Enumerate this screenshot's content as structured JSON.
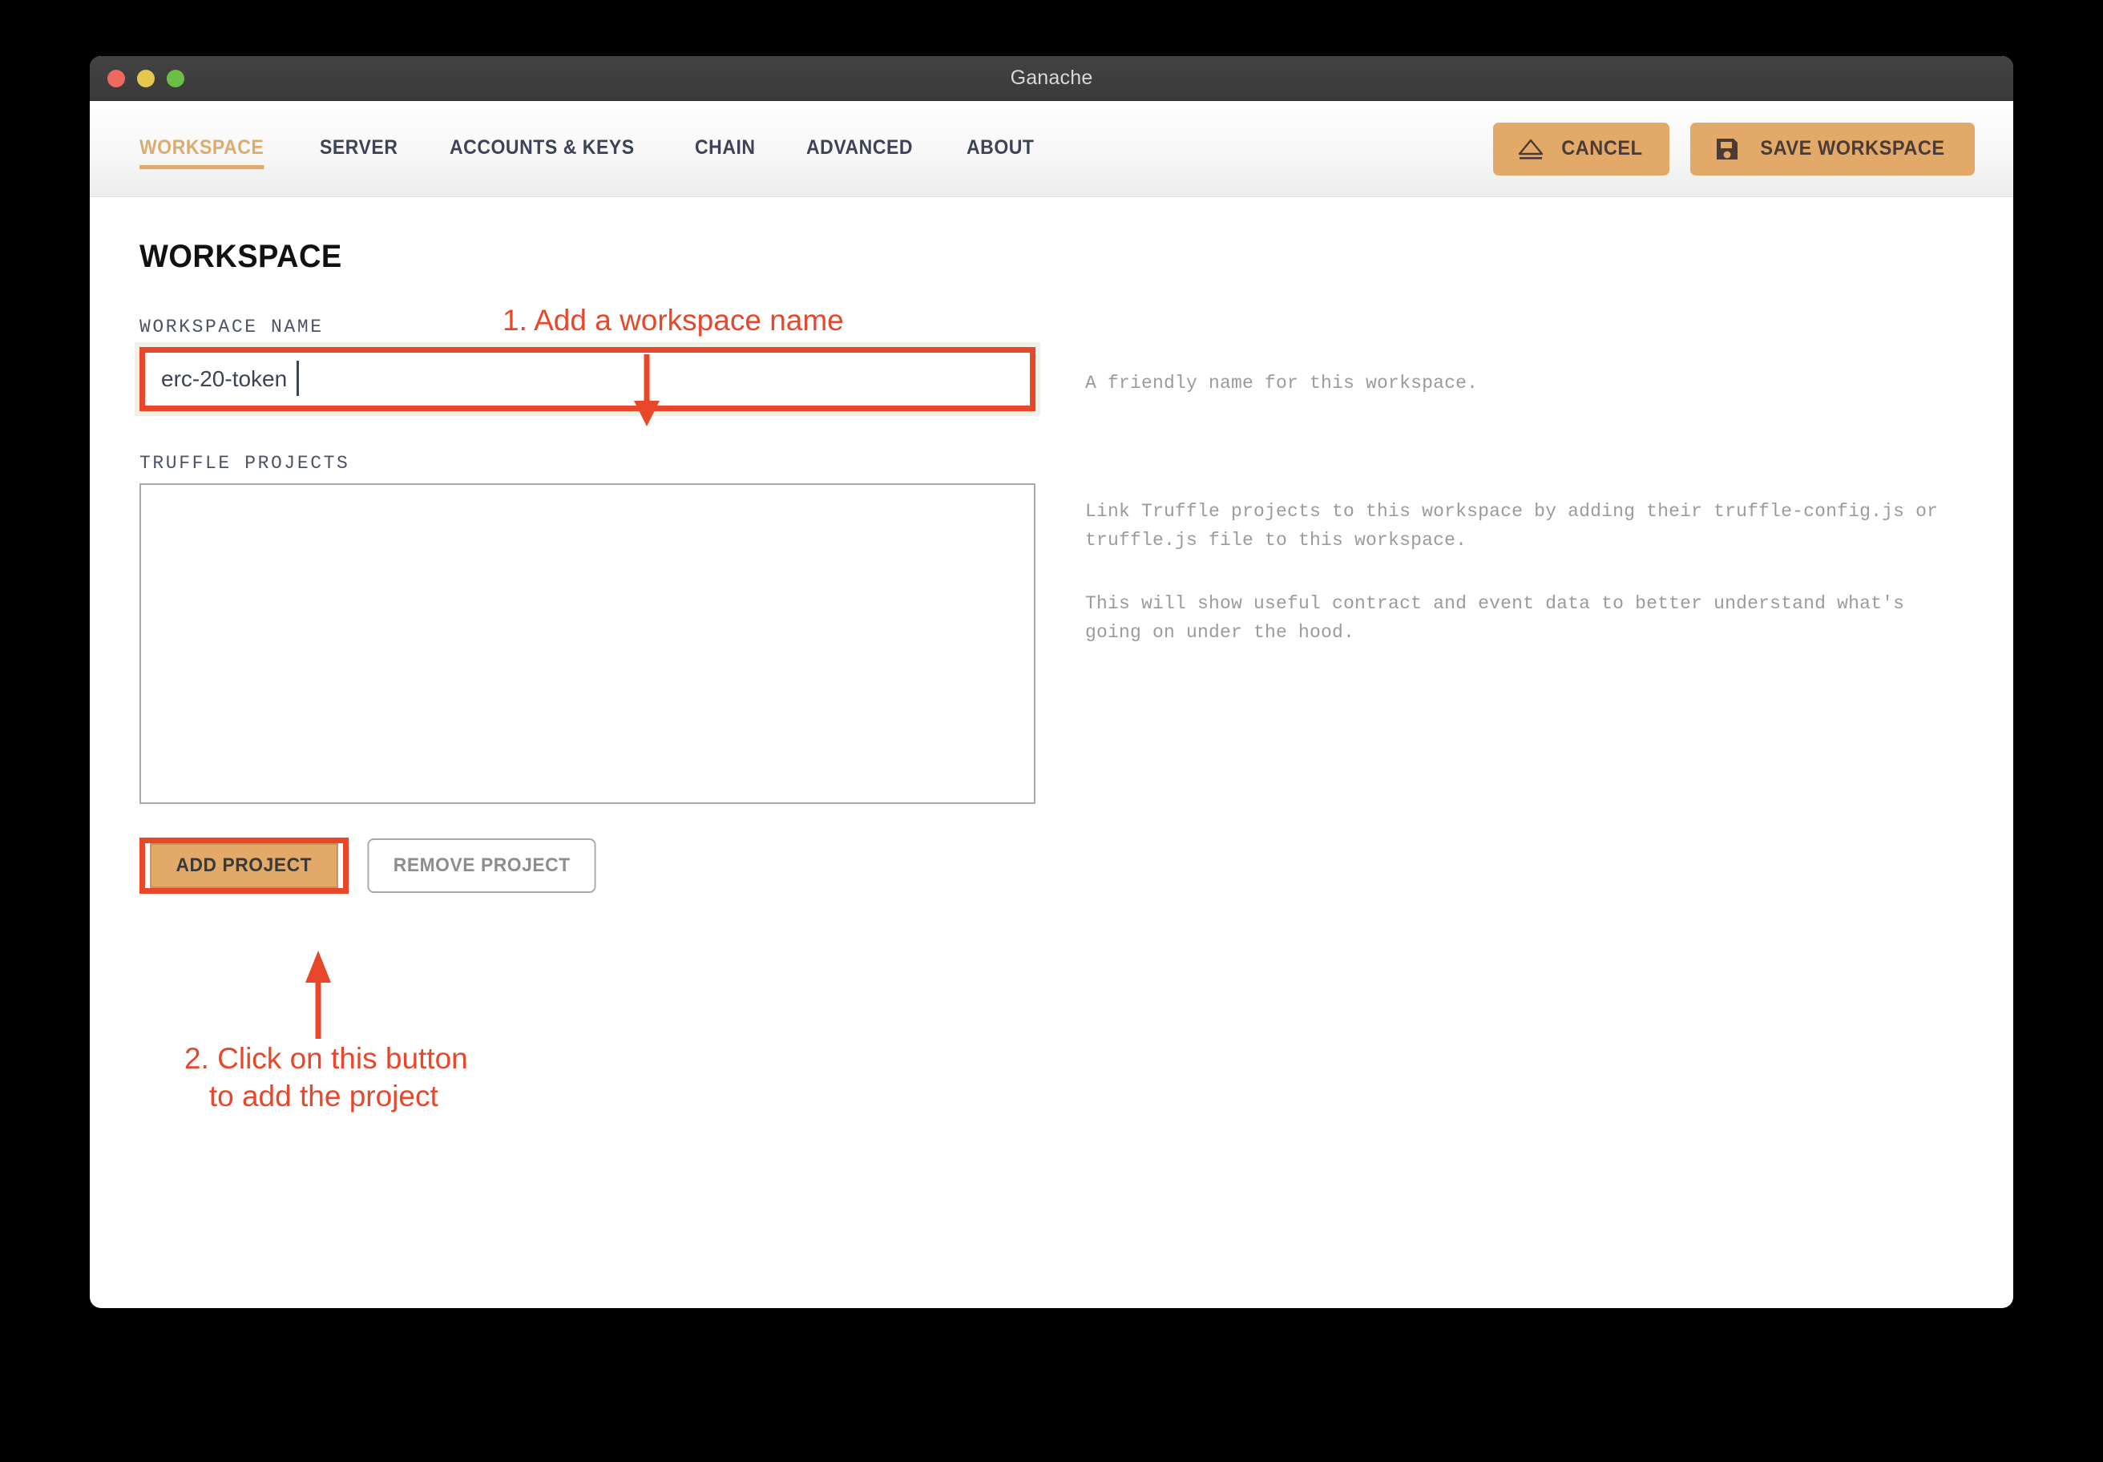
{
  "window": {
    "title": "Ganache",
    "traffic_lights": [
      "close",
      "minimize",
      "zoom"
    ]
  },
  "nav": {
    "tabs": [
      {
        "label": "WORKSPACE",
        "active": true
      },
      {
        "label": "SERVER",
        "active": false
      },
      {
        "label": "ACCOUNTS & KEYS",
        "active": false
      },
      {
        "label": "CHAIN",
        "active": false
      },
      {
        "label": "ADVANCED",
        "active": false
      },
      {
        "label": "ABOUT",
        "active": false
      }
    ]
  },
  "actions": {
    "cancel_label": "CANCEL",
    "cancel_icon": "eject-icon",
    "save_label": "SAVE WORKSPACE",
    "save_icon": "floppy-disk-icon"
  },
  "main": {
    "section_title": "WORKSPACE",
    "workspace_name_label": "WORKSPACE NAME",
    "workspace_name_value": "erc-20-token",
    "workspace_name_placeholder": "",
    "workspace_name_help": "A friendly name for this workspace.",
    "truffle_projects_label": "TRUFFLE PROJECTS",
    "truffle_projects_items": [],
    "truffle_help_1": "Link Truffle projects to this workspace by adding their truffle-config.js or truffle.js file to this workspace.",
    "truffle_help_2": "This will show useful contract and event data to better understand what's going on under the hood.",
    "add_project_label": "ADD PROJECT",
    "remove_project_label": "REMOVE PROJECT"
  },
  "annotations": [
    {
      "id": "1",
      "text": "1. Add a workspace name",
      "arrow": "down"
    },
    {
      "id": "2",
      "text": "2. Click on this button\n   to add the project",
      "arrow": "up"
    }
  ],
  "colors": {
    "accent_tan": "#e3a969",
    "active_tab": "#dbab70",
    "annotation_red": "#e8472a",
    "help_text_gray": "#9b9b9b",
    "titlebar_gray": "#3a3a3a"
  }
}
